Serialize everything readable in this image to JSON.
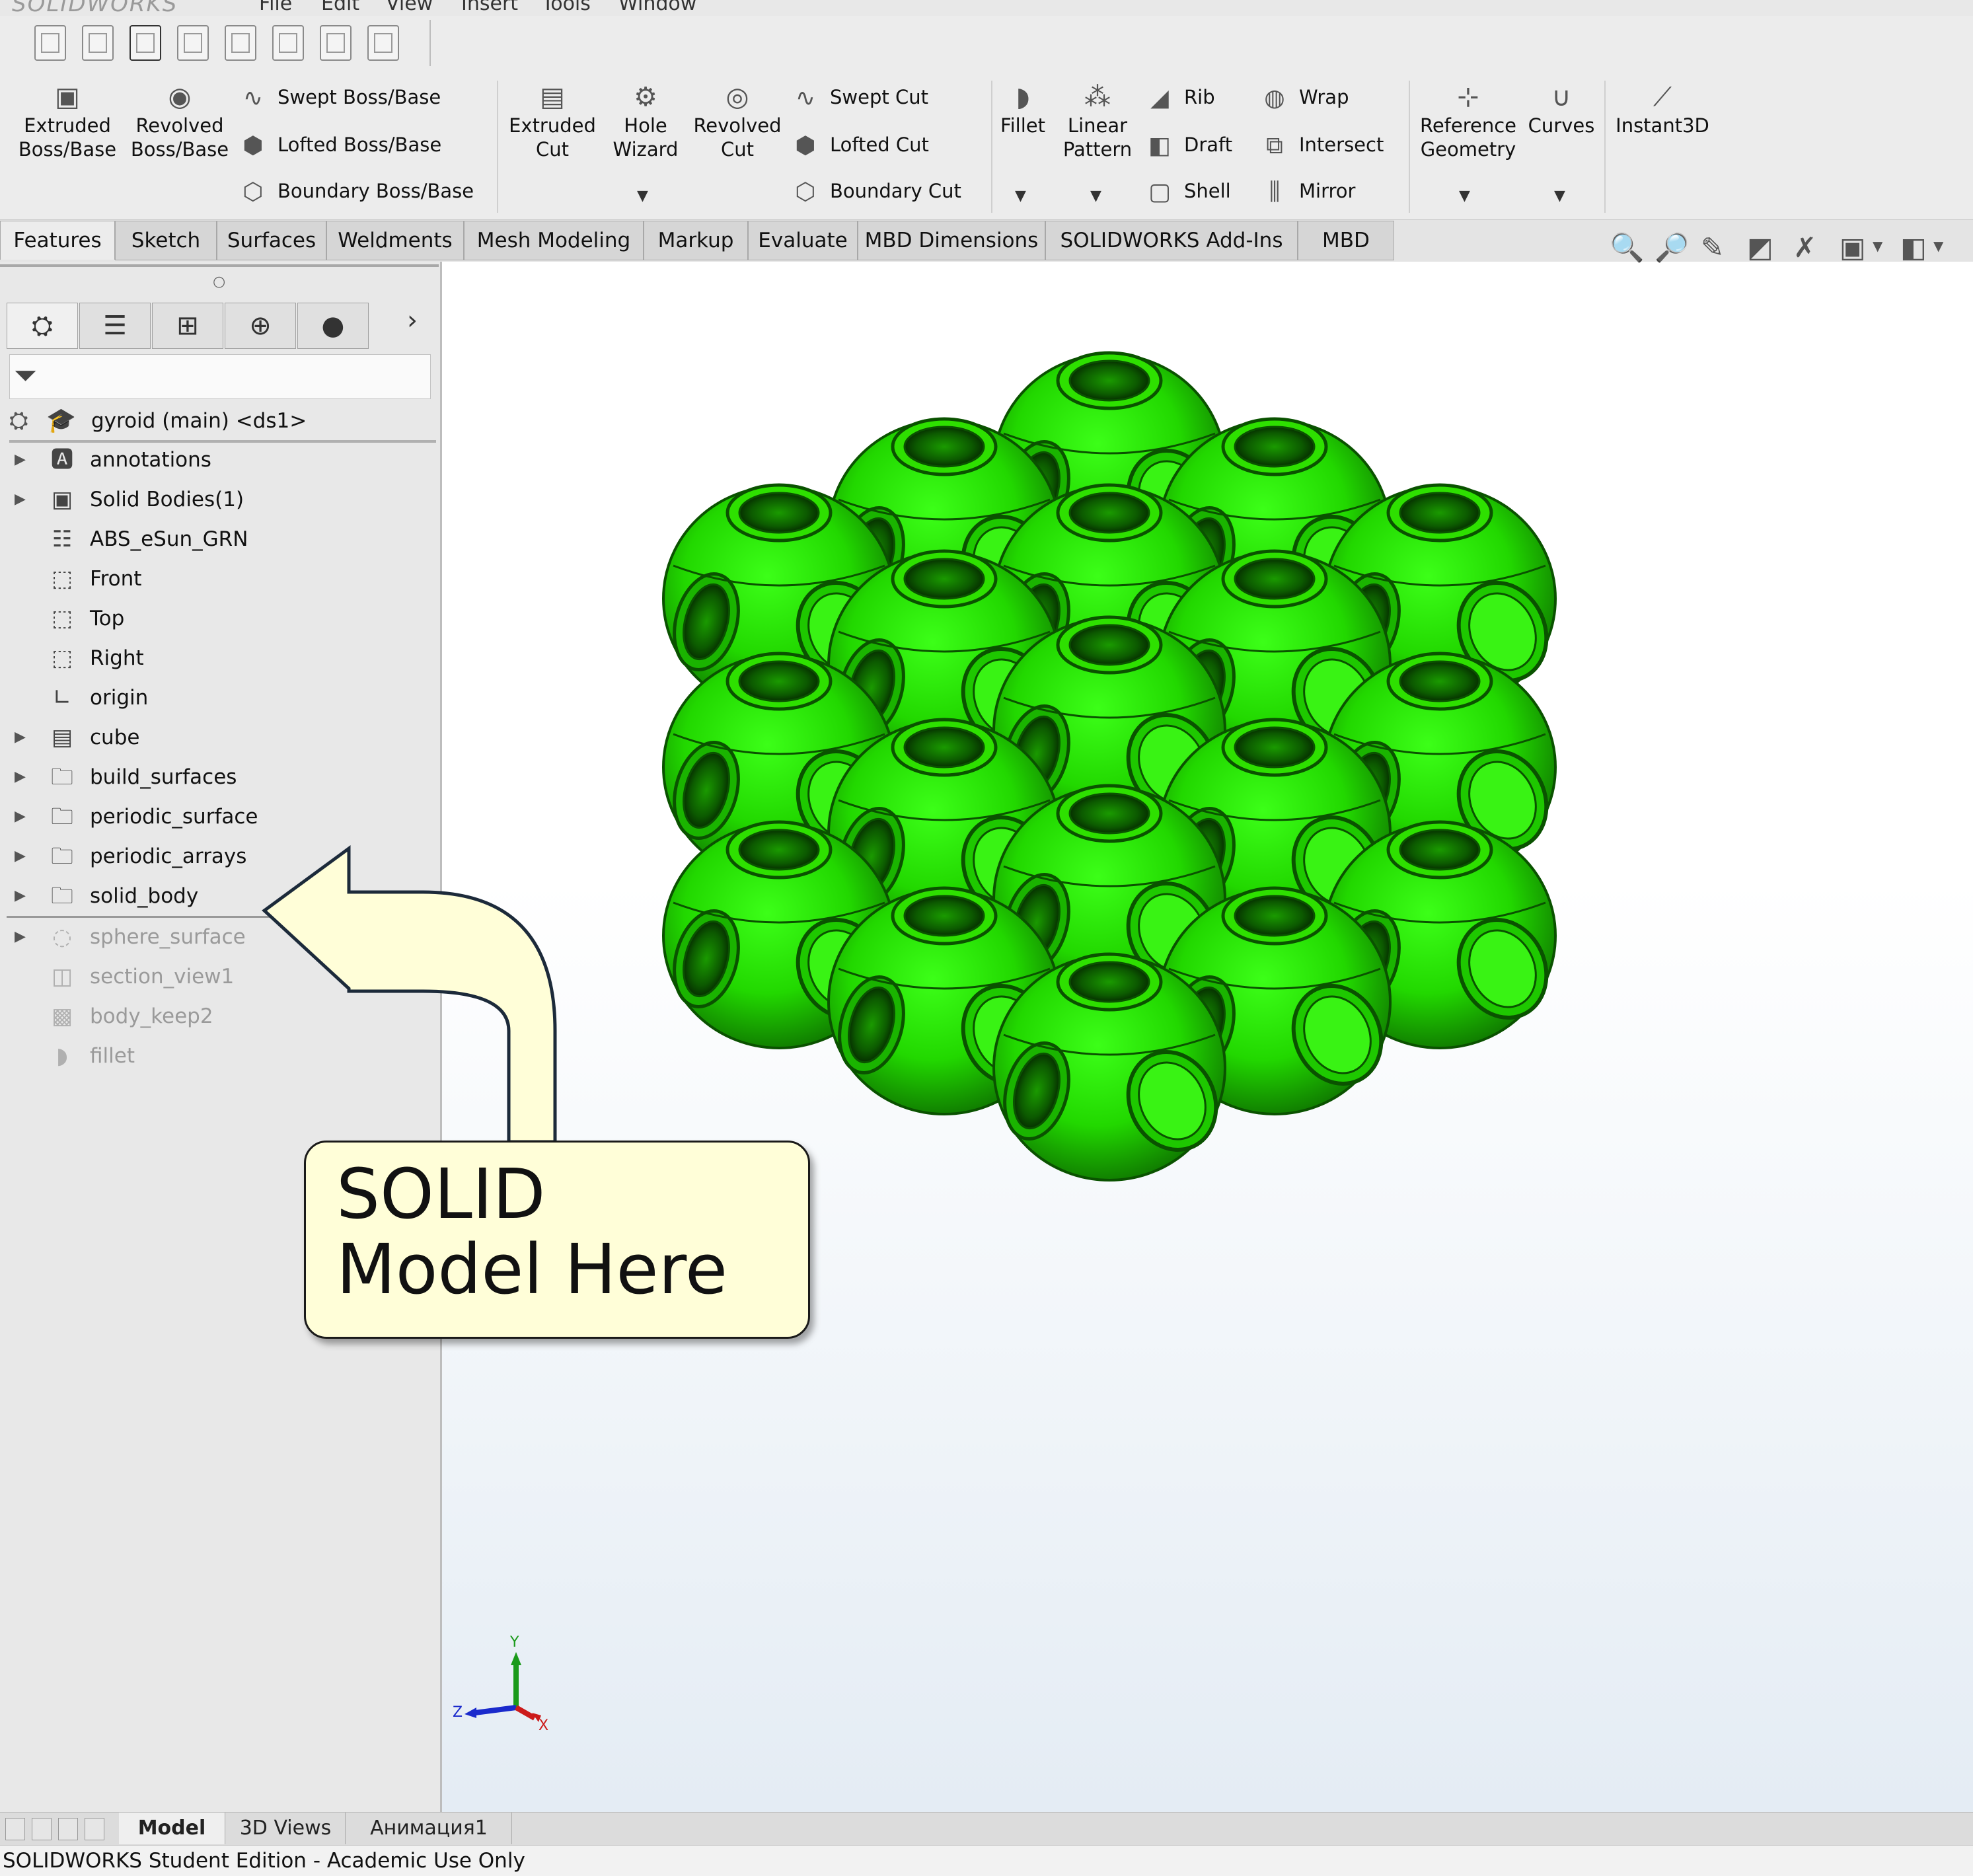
{
  "menu": {
    "logo": "SOLIDWORKS",
    "items": [
      "File",
      "Edit",
      "View",
      "Insert",
      "Tools",
      "Window"
    ]
  },
  "ribbon": {
    "extruded_boss": [
      "Extruded",
      "Boss/Base"
    ],
    "revolved_boss": [
      "Revolved",
      "Boss/Base"
    ],
    "swept_boss": "Swept Boss/Base",
    "lofted_boss": "Lofted Boss/Base",
    "boundary_boss": "Boundary Boss/Base",
    "extruded_cut": [
      "Extruded",
      "Cut"
    ],
    "hole_wizard": [
      "Hole",
      "Wizard"
    ],
    "revolved_cut": [
      "Revolved",
      "Cut"
    ],
    "swept_cut": "Swept Cut",
    "lofted_cut": "Lofted Cut",
    "boundary_cut": "Boundary Cut",
    "fillet": "Fillet",
    "linear_pattern": [
      "Linear",
      "Pattern"
    ],
    "rib": "Rib",
    "draft": "Draft",
    "shell": "Shell",
    "wrap": "Wrap",
    "intersect": "Intersect",
    "mirror": "Mirror",
    "reference_geometry": [
      "Reference",
      "Geometry"
    ],
    "curves": "Curves",
    "instant3d": "Instant3D"
  },
  "tabs": [
    "Features",
    "Sketch",
    "Surfaces",
    "Weldments",
    "Mesh Modeling",
    "Markup",
    "Evaluate",
    "MBD Dimensions",
    "SOLIDWORKS Add-Ins",
    "MBD"
  ],
  "tree": {
    "root": "gyroid (main) <ds1>",
    "items": [
      {
        "label": "annotations"
      },
      {
        "label": "Solid Bodies(1)"
      },
      {
        "label": "ABS_eSun_GRN"
      },
      {
        "label": "Front"
      },
      {
        "label": "Top"
      },
      {
        "label": "Right"
      },
      {
        "label": "origin"
      },
      {
        "label": "cube"
      },
      {
        "label": "build_surfaces"
      },
      {
        "label": "periodic_surface"
      },
      {
        "label": "periodic_arrays"
      },
      {
        "label": "solid_body"
      },
      {
        "label": "sphere_surface"
      },
      {
        "label": "section_view1"
      },
      {
        "label": "body_keep2"
      },
      {
        "label": "fillet"
      }
    ]
  },
  "callout": {
    "line1": "SOLID",
    "line2": "Model Here"
  },
  "triad": {
    "y": "Y",
    "z": "Z",
    "x": "X"
  },
  "bottom_tabs": [
    "Model",
    "3D Views",
    "Анимация1"
  ],
  "status": "SOLIDWORKS Student Edition - Academic Use Only",
  "colors": {
    "model_green": "#22dd00",
    "model_dark": "#0a5200",
    "callout_bg": "#fffed8"
  }
}
